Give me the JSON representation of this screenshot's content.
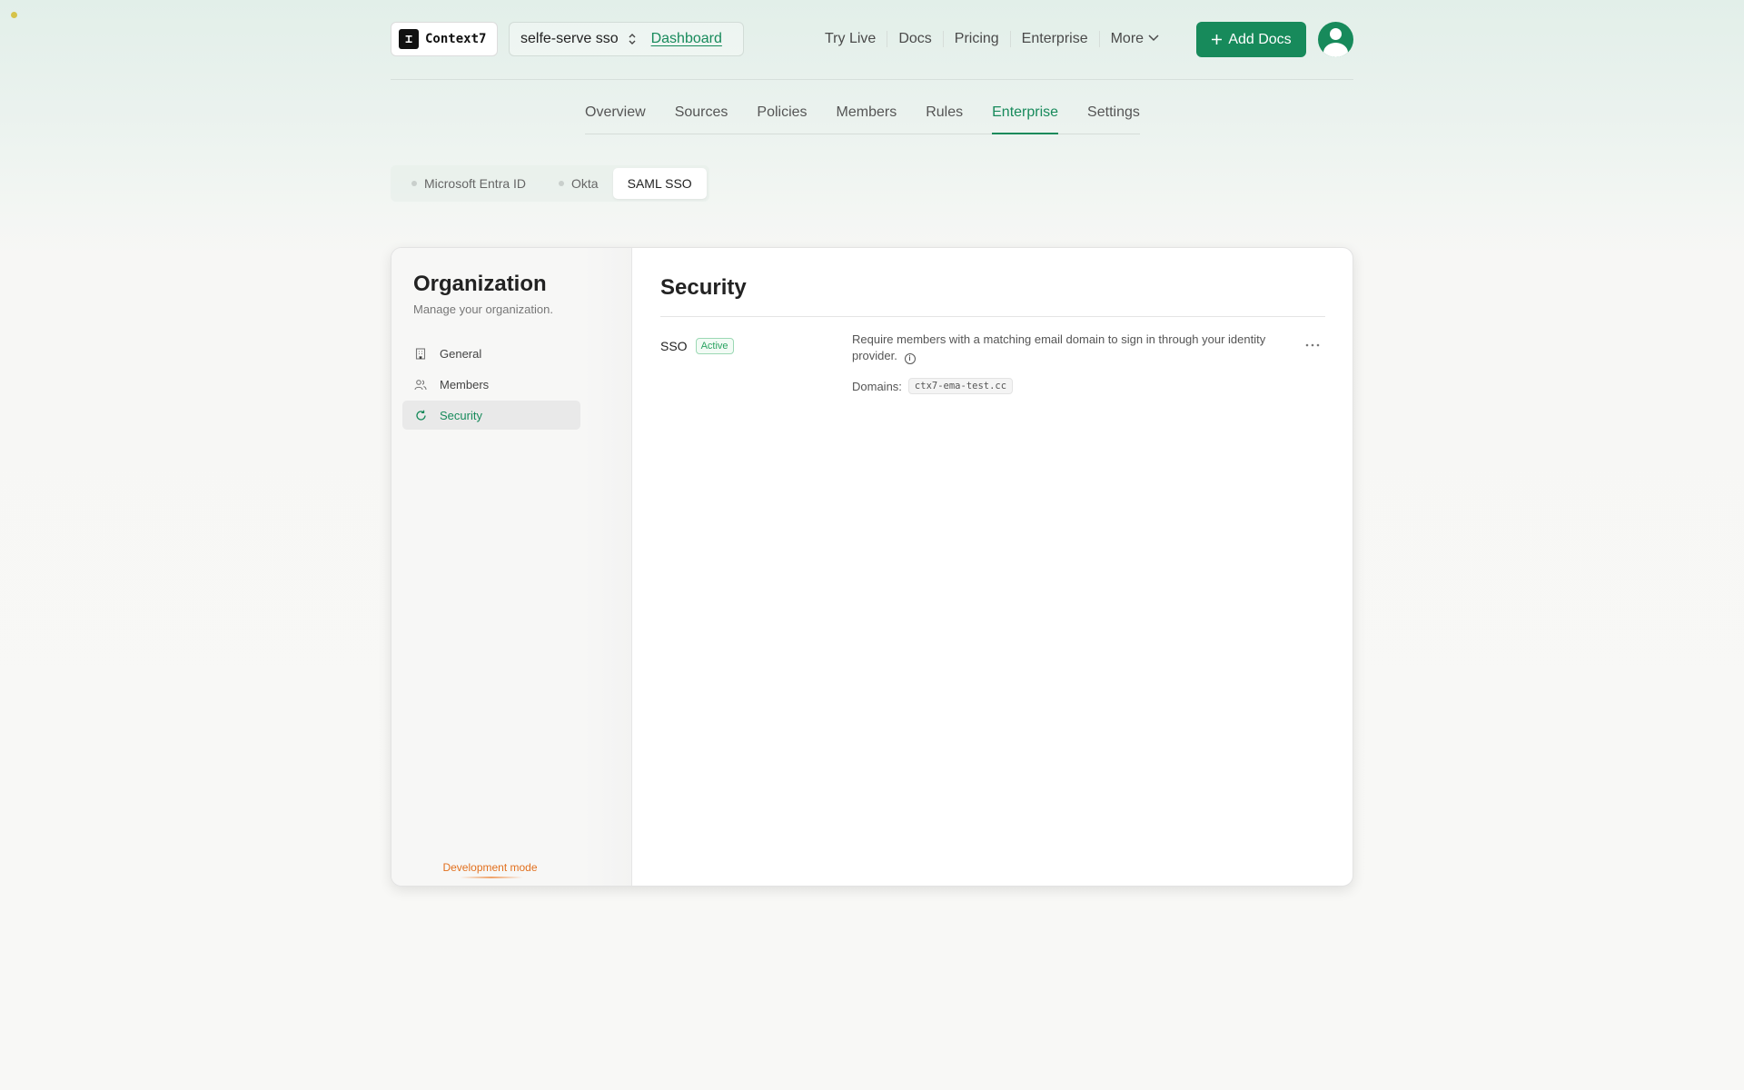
{
  "brand": {
    "logo_text": "Context7"
  },
  "org_switcher": {
    "name": "selfe-serve sso",
    "dashboard_link": "Dashboard"
  },
  "top_nav": {
    "links": [
      "Try Live",
      "Docs",
      "Pricing",
      "Enterprise",
      "More"
    ],
    "add_button": "Add Docs"
  },
  "main_tabs": [
    "Overview",
    "Sources",
    "Policies",
    "Members",
    "Rules",
    "Enterprise",
    "Settings"
  ],
  "main_tabs_active": "Enterprise",
  "sub_tabs": [
    "Microsoft Entra ID",
    "Okta",
    "SAML SSO"
  ],
  "sub_tabs_active": "SAML SSO",
  "sidebar": {
    "title": "Organization",
    "subtitle": "Manage your organization.",
    "items": [
      "General",
      "Members",
      "Security"
    ],
    "active": "Security",
    "dev_mode": "Development mode"
  },
  "content": {
    "title": "Security",
    "sso": {
      "label": "SSO",
      "status": "Active",
      "description": "Require members with a matching email domain to sign in through your identity provider.",
      "domains_label": "Domains:",
      "domain": "ctx7-ema-test.cc"
    }
  },
  "colors": {
    "accent": "#178a5b",
    "dev_mode": "#e2701e",
    "badge_green": "#2aa361"
  }
}
